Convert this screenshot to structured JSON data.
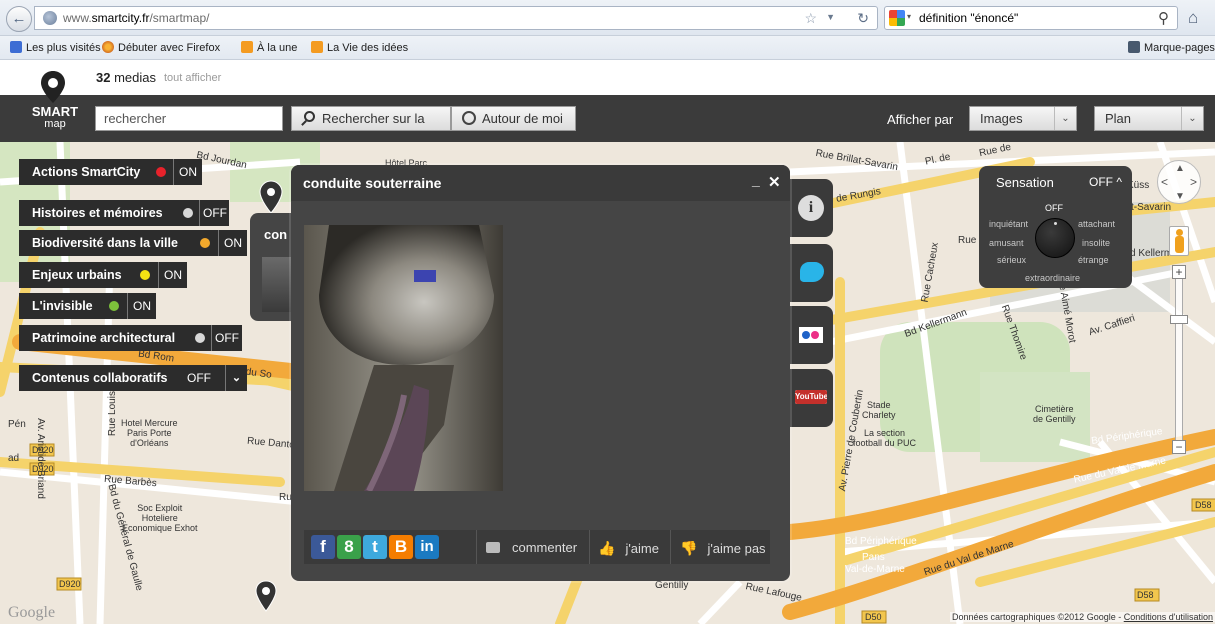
{
  "browser": {
    "url_prefix": "www.",
    "url_domain": "smartcity.fr",
    "url_path": "/smartmap/",
    "search_query": "définition \"énoncé\"",
    "bookmarks": [
      "Les plus visités",
      "Débuter avec Firefox",
      "À la une",
      "La Vie des idées"
    ],
    "bookmarks_menu": "Marque-pages"
  },
  "site": {
    "media_count": "32",
    "media_label": "medias",
    "show_all": "tout afficher",
    "logo_line1": "SMART",
    "logo_line2": "map",
    "search_placeholder": "rechercher",
    "search_button": "Rechercher sur la",
    "near_button": "Autour de moi",
    "display_label": "Afficher par",
    "display_select": "Images",
    "map_select": "Plan"
  },
  "categories": [
    {
      "label": "Actions SmartCity",
      "state": "ON",
      "dot_color": "#e8222b"
    },
    {
      "label": "Histoires et mémoires",
      "state": "OFF",
      "dot_color": "#d8d8d8"
    },
    {
      "label": "Biodiversité dans la ville",
      "state": "ON",
      "dot_color": "#f3a92c"
    },
    {
      "label": "Enjeux urbains",
      "state": "ON",
      "dot_color": "#f4e213"
    },
    {
      "label": "L'invisible",
      "state": "ON",
      "dot_color": "#7dc23b"
    },
    {
      "label": "Patrimoine architectural",
      "state": "OFF",
      "dot_color": "#d8d8d8"
    }
  ],
  "collab": {
    "label": "Contenus collaboratifs",
    "state": "OFF"
  },
  "popup": {
    "title": "conduite souterraine",
    "behind_title": "con",
    "comment": "commenter",
    "like": "j'aime",
    "dislike": "j'aime pas"
  },
  "social_share": [
    "f",
    "8",
    "t",
    "B",
    "in"
  ],
  "side_icons": {
    "youtube": "YouTube"
  },
  "sensation": {
    "title": "Sensation",
    "state": "OFF",
    "dial_off": "OFF",
    "left": [
      "inquiétant",
      "amusant",
      "sérieux"
    ],
    "right": [
      "attachant",
      "insolite",
      "étrange"
    ],
    "bottom": "extraordinaire"
  },
  "map": {
    "credit_prefix": "Données cartographiques ©2012 Google - ",
    "credit_link": "Conditions d'utilisation",
    "google": "Google",
    "streets": {
      "bd_jourdan": "Bd Jourdan",
      "brillat": "Rue Brillat-Savarin",
      "rungis": "de Rungis",
      "pl_de": "Pl. de",
      "rue_de": "Rue de",
      "rue": "Rue",
      "cacheux": "Rue Cacheux",
      "kellermann": "Bd Kellermann",
      "kellerm_right": "d Kellerm",
      "savarin_right": "t-Savarin",
      "kuss": "Küss",
      "thomire": "Rue Thomire",
      "aime_morot": "Rue Aimé Morot",
      "caffieri": "Av. Caffieri",
      "barbes": "Rue Barbès",
      "danton": "Rue Danton",
      "louis_lejay": "Rue Louis Lej",
      "ruth": "Ru",
      "d920a": "D920",
      "d920b": "D920",
      "d920c": "D920",
      "periph": "Bd Périphérique",
      "periph2": "Bd Périphérique",
      "val_marne": "Rue du Val de Marne",
      "val_marne2": "Rue du Val de Marne",
      "pans": "Pans",
      "val_de_marne": "Val-de-Marne",
      "lafouge": "Rue Lafouge",
      "d58": "D58",
      "d58b": "D58",
      "d50": "D50",
      "coubertin": "Av. Pierre de Coubertin",
      "gentilly": "Gentilly",
      "aristide": "Av. Aristide Briand",
      "general_gaulle": "Bd du Général de Gaulle",
      "ute_du_so": "ute du So",
      "bd_rom": "Bd Rom",
      "pen": "Pén",
      "ad": "ad"
    },
    "pois": {
      "hotel_mercure": "Hotel Mercure\nParis Porte\nd'Orléans",
      "soc_exploit": "Soc Exploit\nHoteliere\nEconomique Exhot",
      "stade": "Stade\nCharlety",
      "section": "La section\nfootball du PUC",
      "cimetiere": "Cimetière\nde Gentilly",
      "hotel_parc": "Hôtel Parc"
    }
  }
}
